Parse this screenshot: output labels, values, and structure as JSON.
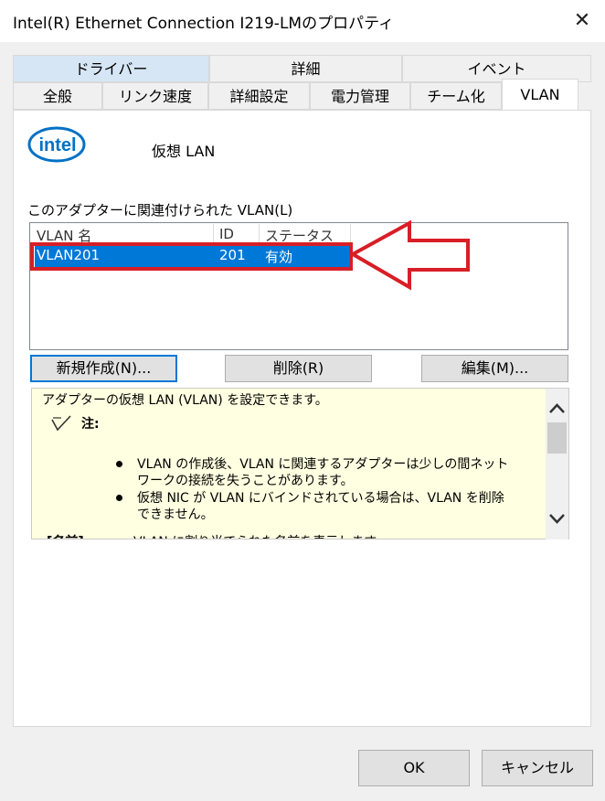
{
  "window": {
    "title": "Intel(R) Ethernet Connection I219-LMのプロパティ",
    "close_glyph": "✕"
  },
  "tabs_row1": [
    {
      "label": "ドライバー"
    },
    {
      "label": "詳細"
    },
    {
      "label": "イベント"
    }
  ],
  "tabs_row2": [
    {
      "label": "全般"
    },
    {
      "label": "リンク速度"
    },
    {
      "label": "詳細設定"
    },
    {
      "label": "電力管理"
    },
    {
      "label": "チーム化"
    },
    {
      "label": "VLAN"
    }
  ],
  "logo": {
    "text": "intel"
  },
  "virtual_name": "仮想 LAN",
  "vlan_group_label": "このアダプターに関連付けられた VLAN(L)",
  "list": {
    "columns": [
      "VLAN 名",
      "ID",
      "ステータス"
    ],
    "rows": [
      {
        "name": "VLAN201",
        "id": "201",
        "status": "有効"
      }
    ]
  },
  "buttons": {
    "new": "新規作成(N)...",
    "delete": "削除(R)",
    "edit": "編集(M)..."
  },
  "note": {
    "intro": "アダプターの仮想 LAN (VLAN) を設定できます。",
    "heading": "注:",
    "bullet1_line1": "VLAN の作成後、VLAN に関連するアダプターは少しの間ネット",
    "bullet1_line2": "ワークの接続を失うことがあります。",
    "bullet2_line1": "仮想 NIC が VLAN にバインドされている場合は、VLAN を削除",
    "bullet2_line2": "できません。",
    "cut_label": "[名前]",
    "cut_text": "VLAN に割り当てられた名前を表示します。"
  },
  "footer": {
    "ok": "OK",
    "cancel": "キャンセル"
  },
  "colors": {
    "selection": "#0078d7",
    "highlight_box": "#d81e26",
    "note_bg": "#ffffe1",
    "intel_blue": "#0071c5"
  }
}
